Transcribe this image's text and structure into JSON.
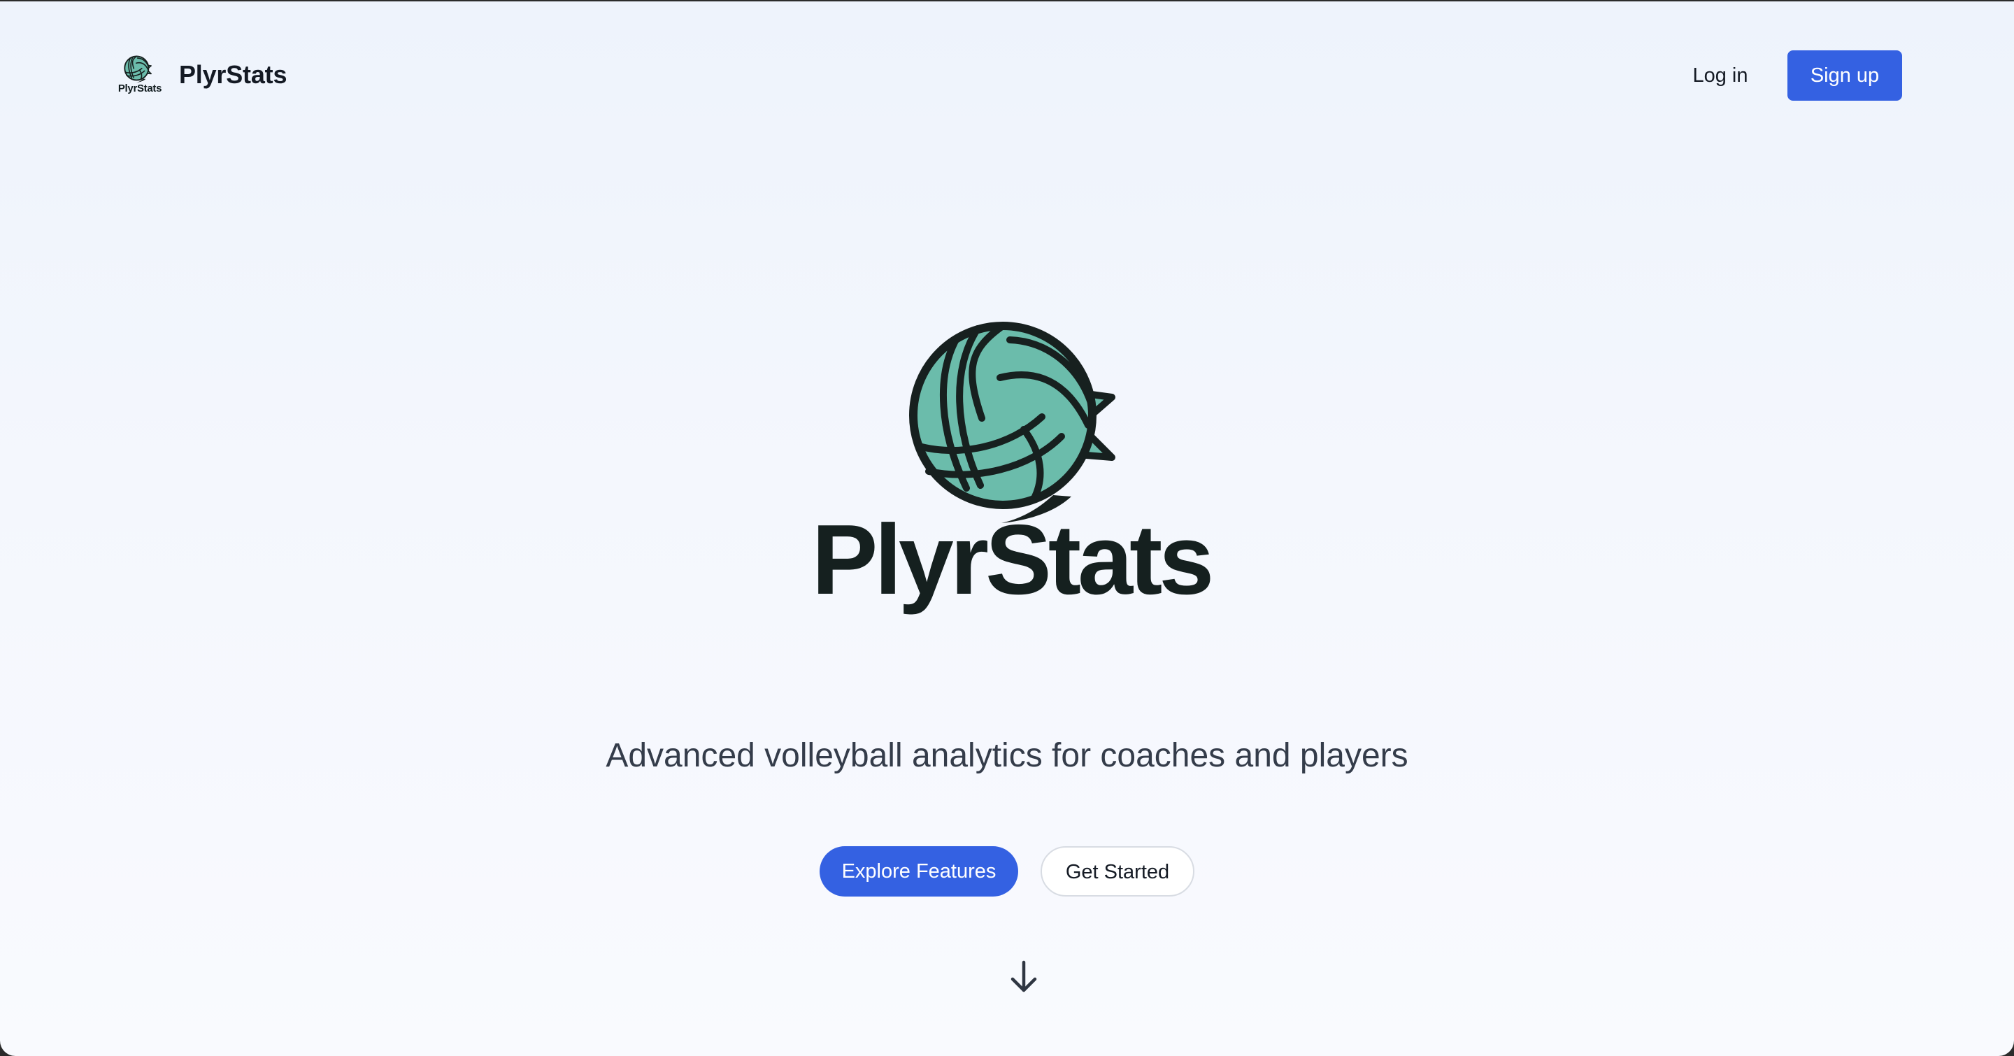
{
  "header": {
    "brand_name": "PlyrStats",
    "brand_mark_text": "PlyrStats",
    "login_label": "Log in",
    "signup_label": "Sign up"
  },
  "hero": {
    "wordmark": "PlyrStats",
    "tagline": "Advanced volleyball analytics for coaches and players",
    "primary_cta": "Explore Features",
    "secondary_cta": "Get Started",
    "scroll_icon": "arrow-down-icon",
    "logo_icon": "volleyball-icon"
  },
  "colors": {
    "accent": "#3461e2",
    "logo_teal": "#6bbcab",
    "logo_outline": "#17201f",
    "background": "#f2f6fd",
    "text_dark": "#141a24"
  }
}
